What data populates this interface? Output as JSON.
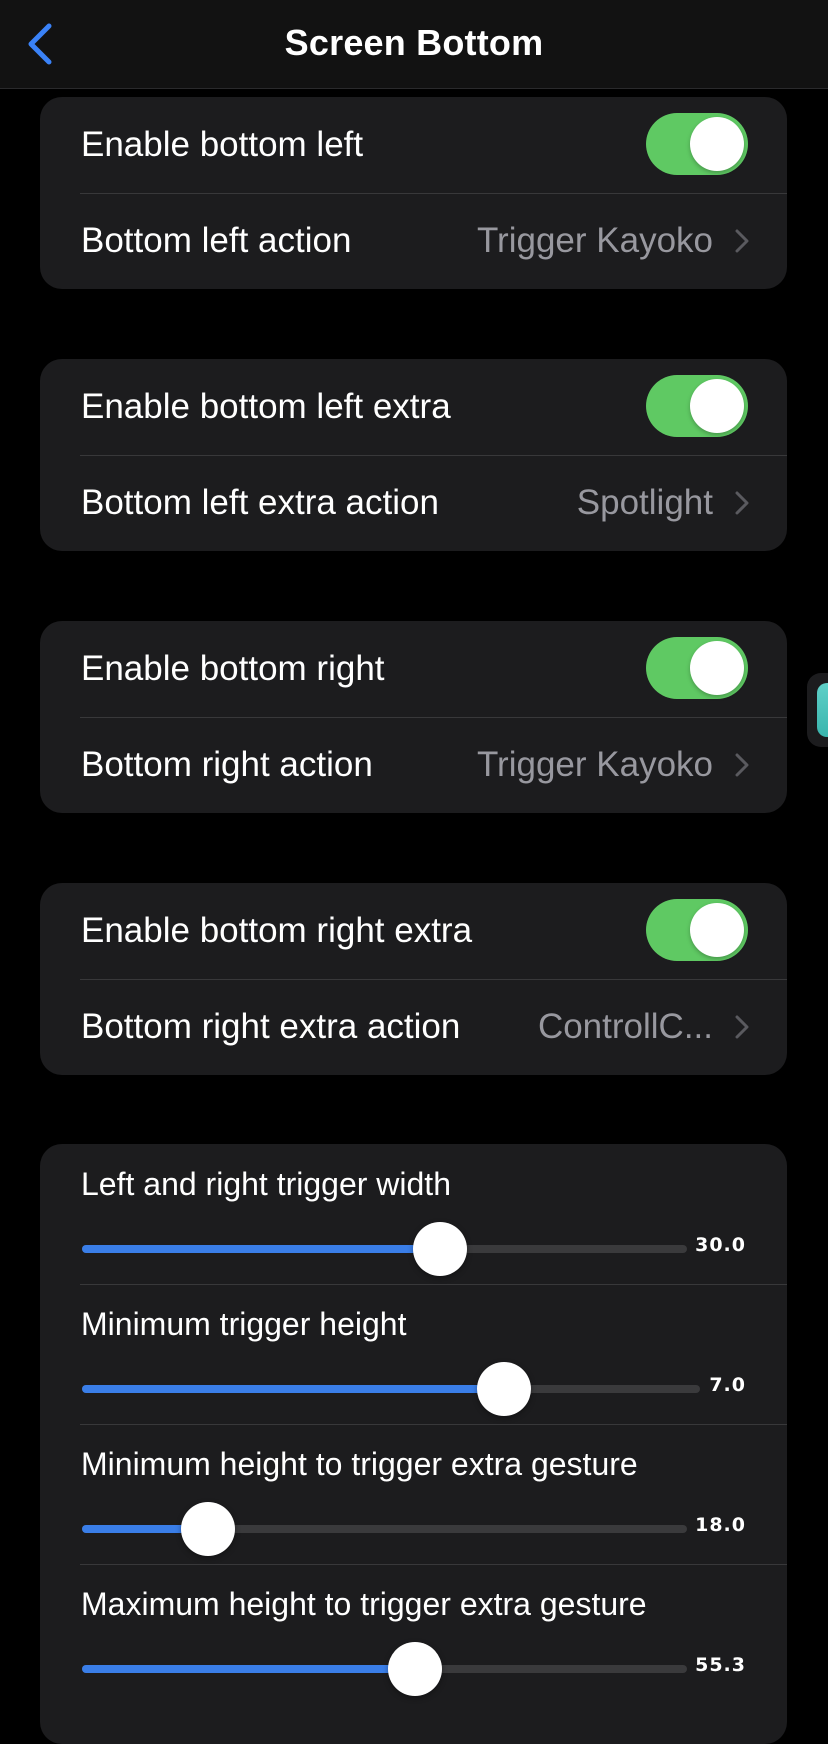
{
  "header": {
    "title": "Screen Bottom",
    "back_icon": "chevron-left-icon"
  },
  "accent_color": "#3a7ee8",
  "toggle_on_color": "#5fc963",
  "groups": [
    {
      "toggle": {
        "label": "Enable bottom left",
        "on": true
      },
      "action": {
        "label": "Bottom left action",
        "value": "Trigger Kayoko"
      }
    },
    {
      "toggle": {
        "label": "Enable bottom left extra",
        "on": true
      },
      "action": {
        "label": "Bottom left extra action",
        "value": "Spotlight"
      }
    },
    {
      "toggle": {
        "label": "Enable bottom right",
        "on": true
      },
      "action": {
        "label": "Bottom right action",
        "value": "Trigger Kayoko"
      }
    },
    {
      "toggle": {
        "label": "Enable bottom right extra",
        "on": true
      },
      "action": {
        "label": "Bottom right extra action",
        "value": "ControllC..."
      }
    }
  ],
  "sliders": [
    {
      "label": "Left and right trigger width",
      "value": "30.0",
      "fraction": 0.6
    },
    {
      "label": "Minimum trigger height",
      "value": "7.0",
      "fraction": 0.7
    },
    {
      "label": "Minimum height to trigger extra gesture",
      "value": "18.0",
      "fraction": 0.18
    },
    {
      "label": "Maximum height to trigger extra gesture",
      "value": "55.3",
      "fraction": 0.555
    }
  ],
  "floating_widget": {
    "icon": "assistive-touch-icon"
  }
}
